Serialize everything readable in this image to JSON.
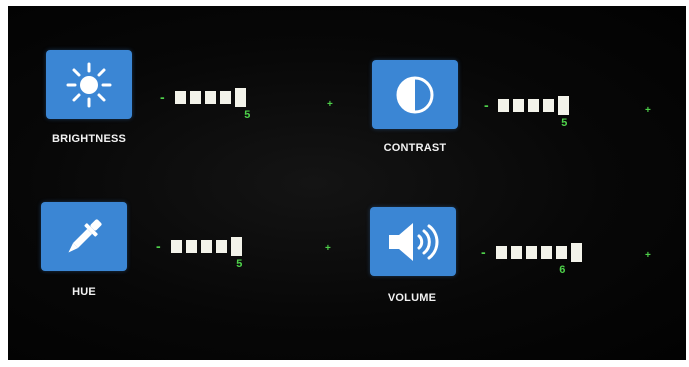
{
  "settings": [
    {
      "id": "brightness",
      "label": "BRIGHTNESS",
      "icon": "sun-icon",
      "level": 5,
      "minus": "-",
      "plus": "+"
    },
    {
      "id": "contrast",
      "label": "CONTRAST",
      "icon": "contrast-icon",
      "level": 5,
      "minus": "-",
      "plus": "+"
    },
    {
      "id": "hue",
      "label": "HUE",
      "icon": "dropper-icon",
      "level": 5,
      "minus": "-",
      "plus": "+"
    },
    {
      "id": "volume",
      "label": "VOLUME",
      "icon": "speaker-icon",
      "level": 6,
      "minus": "-",
      "plus": "+"
    }
  ],
  "colors": {
    "tile": "#3b86d4",
    "accent_green": "#4ed14a",
    "segment": "#f3f3ea",
    "background": "#050505"
  }
}
